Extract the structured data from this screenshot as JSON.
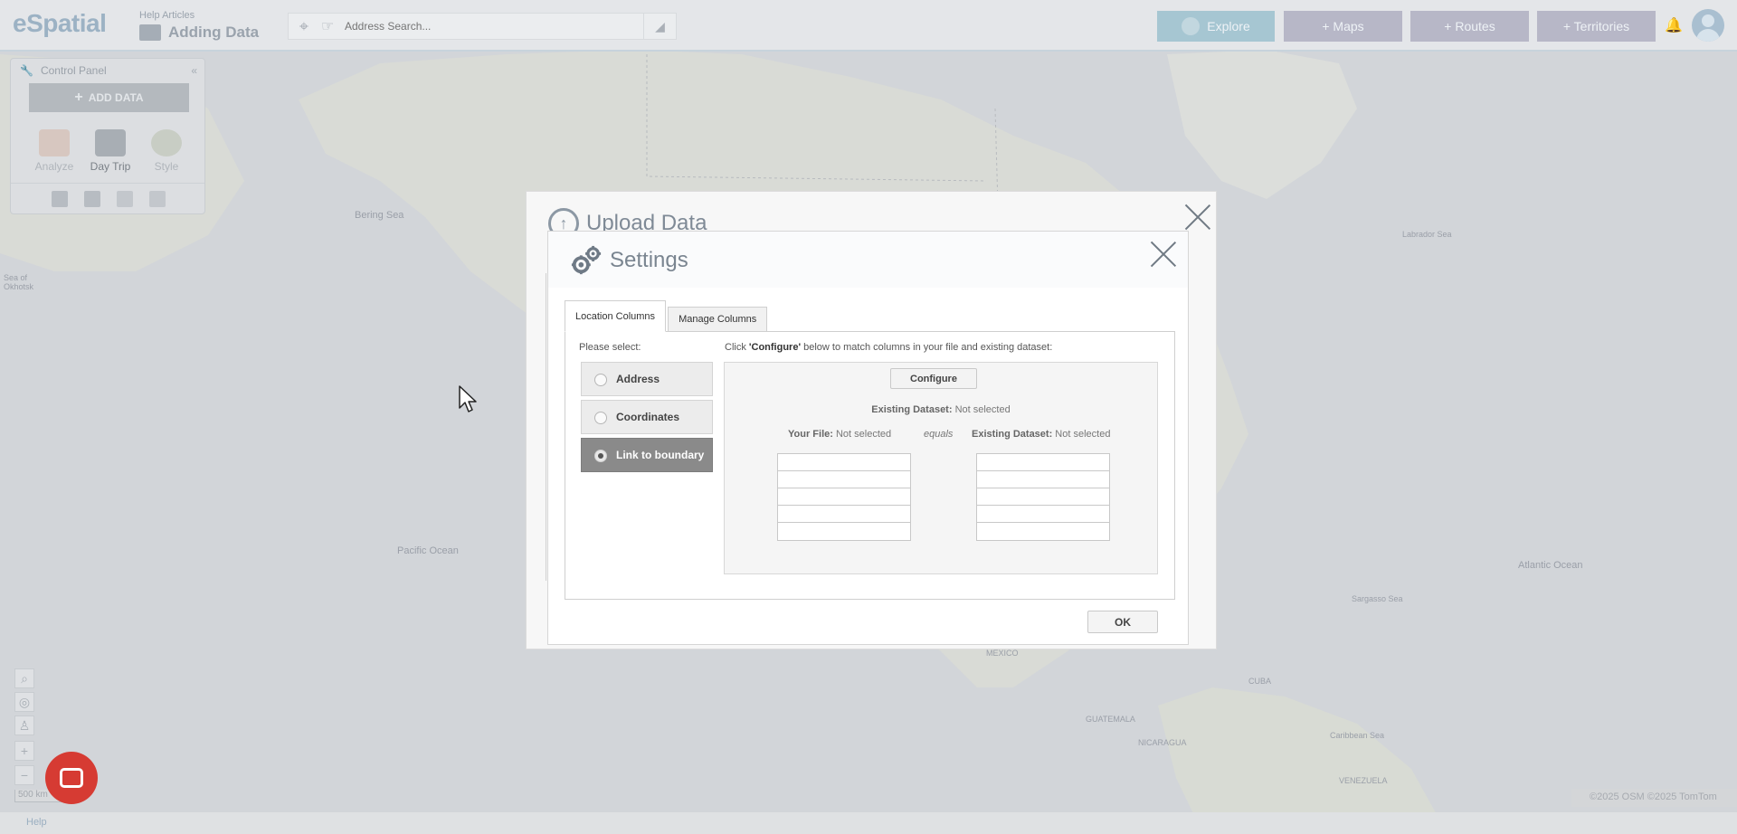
{
  "header": {
    "logo": "eSpatial",
    "help_articles": "Help Articles",
    "page_title": "Adding Data",
    "search_placeholder": "Address Search...",
    "buttons": {
      "explore": "Explore",
      "maps": "+ Maps",
      "routes": "+ Routes",
      "territories": "+ Territories"
    }
  },
  "control_panel": {
    "title": "Control Panel",
    "add_data": "ADD DATA",
    "tools": [
      "Analyze",
      "Day Trip",
      "Style"
    ]
  },
  "map": {
    "labels": {
      "bering_sea": "Bering Sea",
      "sea_of_okhotsk": "Sea of Okhotsk",
      "labrador_sea": "Labrador Sea",
      "pacific_ocean": "Pacific Ocean",
      "atlantic_ocean": "Atlantic Ocean",
      "sargasso_sea": "Sargasso Sea",
      "mexico": "MÉXICO",
      "caribbean_sea": "Caribbean Sea",
      "guatemala": "GUATEMALA",
      "nicaragua": "NICARAGUA",
      "venezuela": "VENEZUELA",
      "cuba": "CUBA"
    },
    "scale": "500 km",
    "copyright": "©2025 OSM ©2025 TomTom",
    "help": "Help"
  },
  "upload_dialog": {
    "title": "Upload Data"
  },
  "settings_dialog": {
    "title": "Settings",
    "tabs": [
      "Location Columns",
      "Manage Columns"
    ],
    "please_select": "Please select:",
    "options": [
      {
        "label": "Address",
        "selected": false
      },
      {
        "label": "Coordinates",
        "selected": false
      },
      {
        "label": "Link to boundary",
        "selected": true
      }
    ],
    "instruction_prefix": "Click ",
    "instruction_bold": "'Configure'",
    "instruction_suffix": " below to match columns in your file and existing dataset:",
    "configure_button": "Configure",
    "existing_label": "Existing Dataset:",
    "existing_value": " Not selected",
    "your_file_label": "Your File:",
    "your_file_value": " Not selected",
    "equals": "equals",
    "existing_right_label": "Existing Dataset:",
    "existing_right_value": " Not selected",
    "ok_button": "OK"
  },
  "colors": {
    "explore": "#a6c6d2",
    "nav_button": "#b7b7c7",
    "selected_option": "#8a8a8a",
    "chat": "#d63b33"
  }
}
